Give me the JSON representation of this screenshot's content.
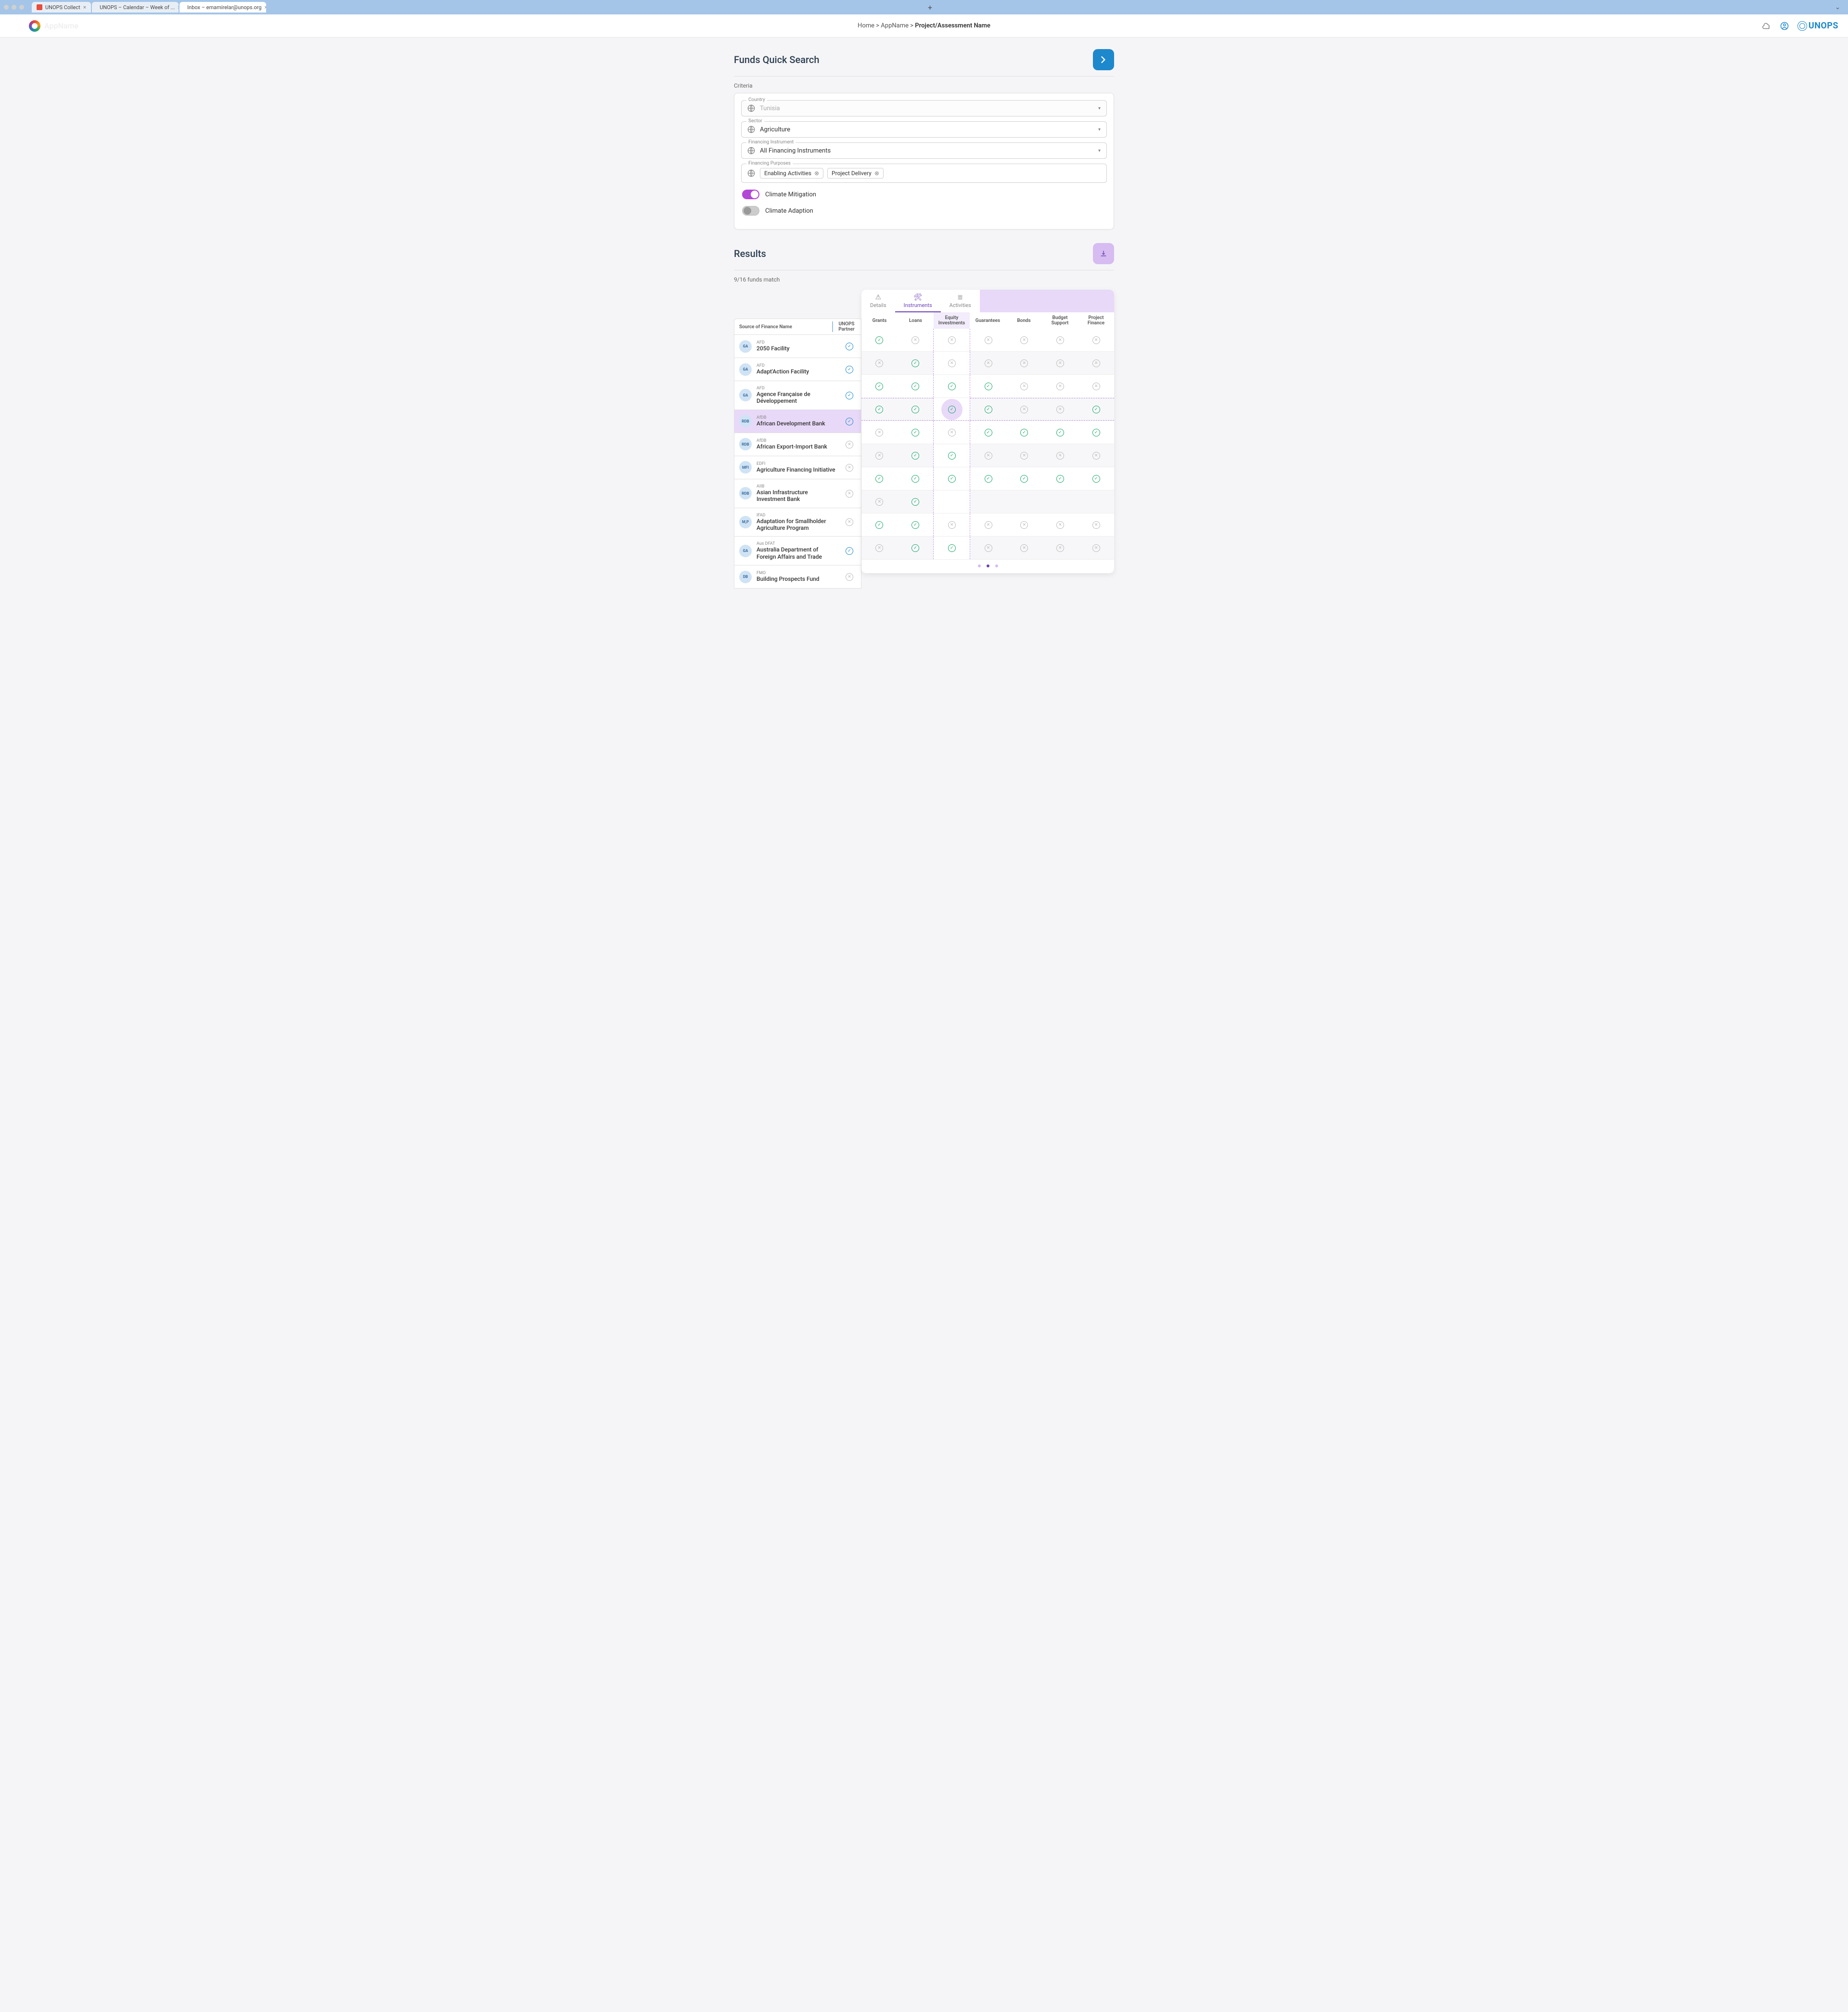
{
  "browser": {
    "tabs": [
      {
        "icon_bg": "#e74c3c",
        "title": "UNOPS Collect"
      },
      {
        "icon_bg": "#27ae60",
        "title": "UNOPS – Calendar – Week of ..."
      },
      {
        "icon_bg": "#e74c3c",
        "title": "Inbox – emamirelar@unops.org"
      }
    ],
    "active_tab_index": 2
  },
  "header": {
    "app_name": "AppName",
    "breadcrumb_home": "Home",
    "breadcrumb_app": "AppName",
    "breadcrumb_page": "Project/Assessment Name",
    "logo_text": "UNOPS"
  },
  "search": {
    "title": "Funds Quick Search",
    "criteria_label": "Criteria",
    "country": {
      "label": "Country",
      "value": "Tunisia"
    },
    "sector": {
      "label": "Sector",
      "value": "Agriculture"
    },
    "fin_instr": {
      "label": "Financing Instrument",
      "value": "All Financing Instruments"
    },
    "fin_purp": {
      "label": "Financing Purposes",
      "chips": [
        "Enabling Activities",
        "Project Delivery"
      ]
    },
    "toggles": [
      {
        "label": "Climate Mitigation",
        "on": true
      },
      {
        "label": "Climate Adaption",
        "on": false
      }
    ]
  },
  "results": {
    "title": "Results",
    "match_text": "9/16 funds match",
    "panel_tabs": [
      {
        "label": "Details",
        "icon": "warning"
      },
      {
        "label": "Instruments",
        "icon": "tools"
      },
      {
        "label": "Activities",
        "icon": "list"
      }
    ],
    "active_panel_tab": 1,
    "left_headers": {
      "name": "Source of Finance Name",
      "partner": "UNOPS Partner"
    },
    "columns": [
      "Grants",
      "Loans",
      "Equity Investments",
      "Guarantees",
      "Bonds",
      "Budget Support",
      "Project Finance"
    ],
    "highlight_col": 2,
    "highlight_row": 3,
    "rows": [
      {
        "badge": "GA",
        "org": "AFD",
        "name": "2050 Facility",
        "partner": true,
        "cells": [
          true,
          false,
          false,
          false,
          false,
          false,
          false
        ]
      },
      {
        "badge": "GA",
        "org": "AFD",
        "name": "Adapt'Action Facility",
        "partner": true,
        "cells": [
          false,
          true,
          false,
          false,
          false,
          false,
          false
        ]
      },
      {
        "badge": "GA",
        "org": "AFD",
        "name": "Agence Française de Développement",
        "partner": true,
        "cells": [
          true,
          true,
          true,
          true,
          false,
          false,
          false
        ]
      },
      {
        "badge": "RDB",
        "org": "AfDB",
        "name": "African Development Bank",
        "partner": true,
        "cells": [
          true,
          true,
          true,
          true,
          false,
          false,
          true
        ]
      },
      {
        "badge": "RDB",
        "org": "AfDB",
        "name": "African Export-Import Bank",
        "partner": false,
        "cells": [
          false,
          true,
          false,
          true,
          true,
          true,
          true
        ]
      },
      {
        "badge": "MFI",
        "org": "EDFI",
        "name": "Agriculture Financing Initiative",
        "partner": false,
        "cells": [
          false,
          true,
          true,
          false,
          false,
          false,
          false
        ]
      },
      {
        "badge": "RDB",
        "org": "AIIB",
        "name": "Asian Infrastructure Investment Bank",
        "partner": false,
        "cells": [
          true,
          true,
          true,
          true,
          true,
          true,
          true
        ]
      },
      {
        "badge": "M,P",
        "org": "IFAD",
        "name": "Adaptation for Smallholder Agriculture Program",
        "partner": false,
        "cells": [
          false,
          true,
          null,
          null,
          null,
          null,
          null
        ]
      },
      {
        "badge": "GA",
        "org": "Aus DFAT",
        "name": "Australia Department of Foreign Affairs and Trade",
        "partner": true,
        "cells": [
          true,
          true,
          false,
          false,
          false,
          false,
          false
        ]
      },
      {
        "badge": "DB",
        "org": "FMO",
        "name": "Building Prospects Fund",
        "partner": false,
        "cells": [
          false,
          true,
          true,
          false,
          false,
          false,
          false
        ]
      }
    ],
    "pager": {
      "count": 3,
      "active": 1
    }
  }
}
